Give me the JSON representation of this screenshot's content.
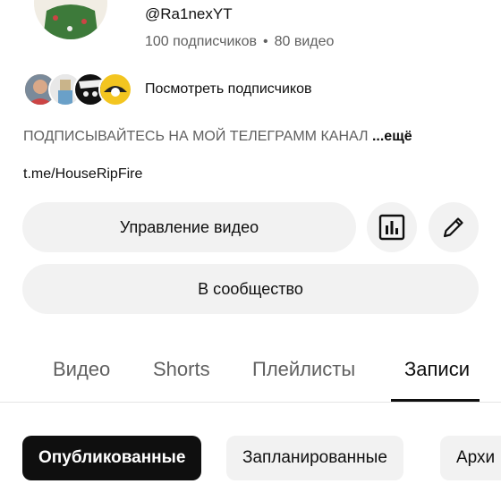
{
  "channel": {
    "handle": "@Ra1nexYT",
    "subscribers": "100 подписчиков",
    "separator": "•",
    "videos": "80 видео"
  },
  "subscribers_preview": {
    "label": "Посмотреть подписчиков"
  },
  "description": {
    "text": "ПОДПИСЫВАЙТЕСЬ НА МОЙ ТЕЛЕГРАММ КАНАЛ ",
    "more": "...ещё",
    "link": "t.me/HouseRipFire"
  },
  "actions": {
    "manage_videos": "Управление видео",
    "stats_icon": "bar-chart-icon",
    "edit_icon": "pencil-icon",
    "community": "В сообщество"
  },
  "tabs": [
    {
      "label": "Видео",
      "active": false
    },
    {
      "label": "Shorts",
      "active": false
    },
    {
      "label": "Плейлисты",
      "active": false
    },
    {
      "label": "Записи",
      "active": true
    }
  ],
  "filters": [
    {
      "label": "Опубликованные",
      "active": true
    },
    {
      "label": "Запланированные",
      "active": false
    },
    {
      "label": "Архи",
      "active": false
    }
  ],
  "colors": {
    "text": "#0f0f0f",
    "secondary": "#606060",
    "chip_bg": "#f2f2f2"
  }
}
